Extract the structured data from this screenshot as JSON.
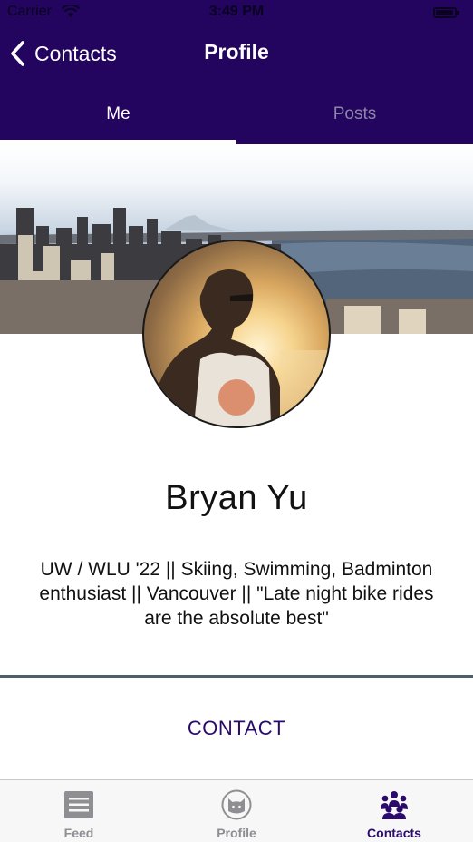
{
  "status_bar": {
    "carrier": "Carrier",
    "time": "3:49 PM"
  },
  "nav": {
    "back_label": "Contacts",
    "title": "Profile"
  },
  "tabs": [
    {
      "label": "Me",
      "active": true
    },
    {
      "label": "Posts",
      "active": false
    }
  ],
  "profile": {
    "name": "Bryan Yu",
    "bio": "UW / WLU '22 || Skiing, Swimming, Badminton enthusiast || Vancouver || \"Late night bike rides are the absolute best\"",
    "contact_label": "CONTACT"
  },
  "tab_bar": {
    "items": [
      {
        "label": "Feed",
        "icon": "feed-icon",
        "selected": false
      },
      {
        "label": "Profile",
        "icon": "cat-profile-icon",
        "selected": false
      },
      {
        "label": "Contacts",
        "icon": "people-icon",
        "selected": true
      }
    ]
  },
  "colors": {
    "nav_background": "#23045f",
    "accent": "#2a0a6b",
    "inactive_tab": "#8d86a6",
    "divider": "#4d5e6d",
    "tab_bar_inactive": "#8e8e93"
  }
}
